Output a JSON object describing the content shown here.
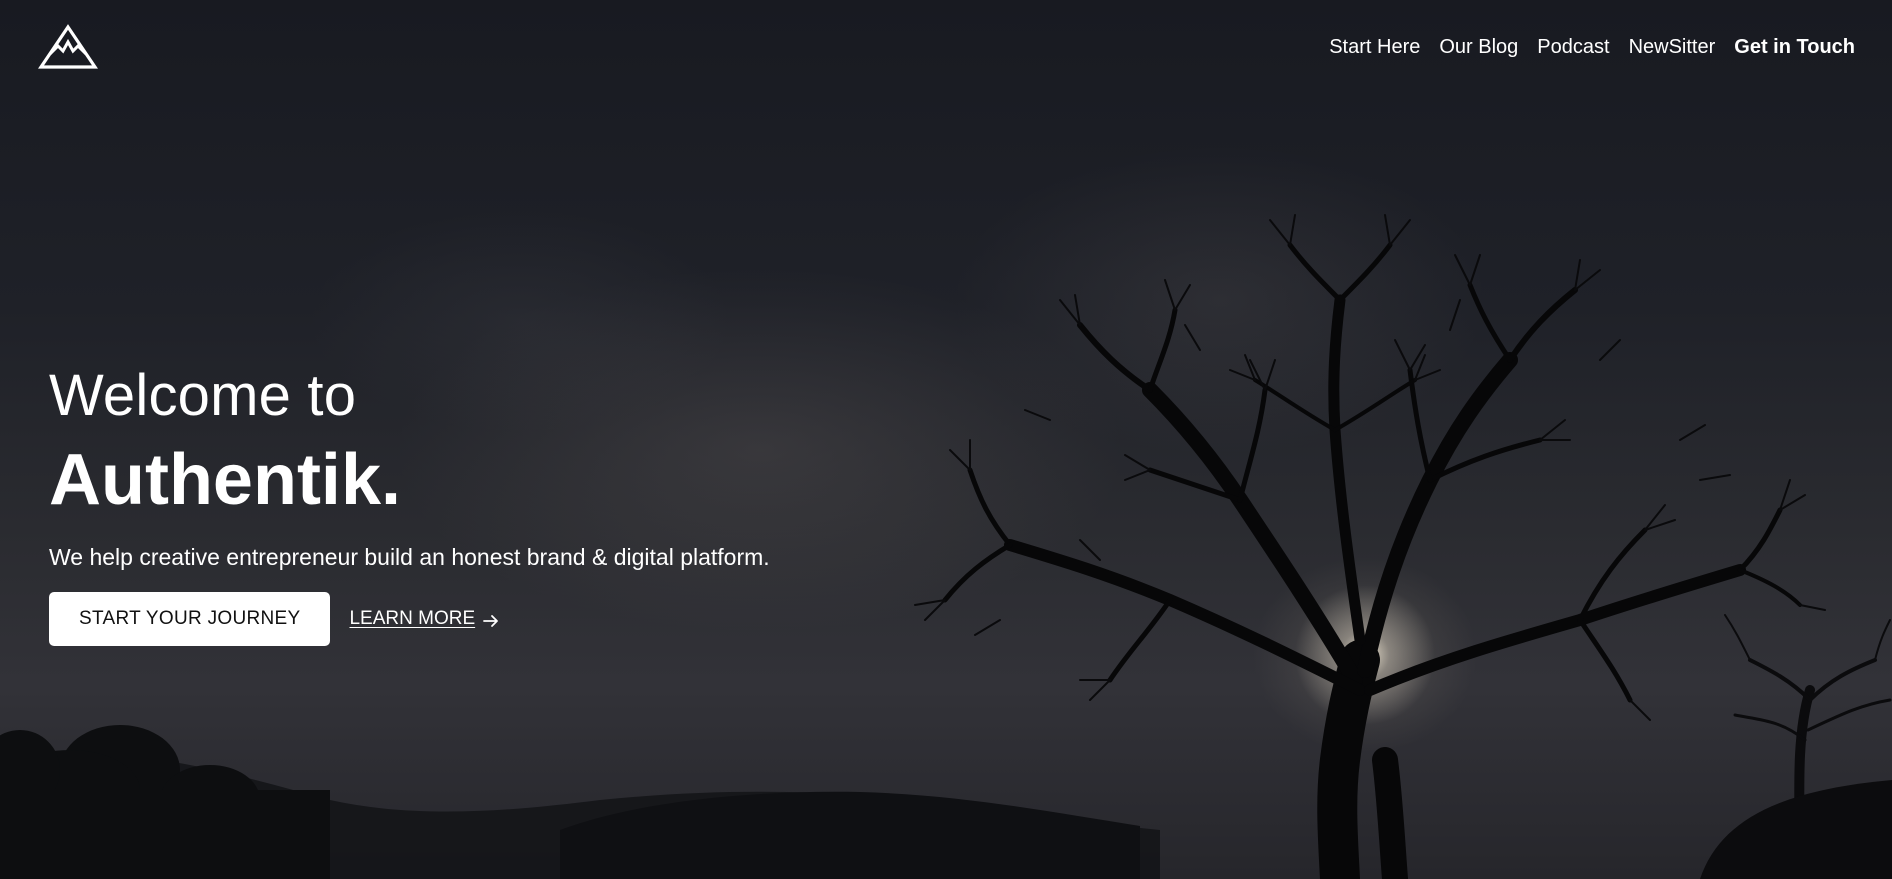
{
  "header": {
    "logo_icon": "mountain-logo-icon",
    "nav": [
      {
        "label": "Start Here"
      },
      {
        "label": "Our Blog"
      },
      {
        "label": "Podcast"
      },
      {
        "label": "NewSitter"
      },
      {
        "label": "Get in Touch"
      }
    ]
  },
  "hero": {
    "welcome": "Welcome to",
    "brand": "Authentik.",
    "tagline": "We help creative entrepreneur build an honest brand & digital platform.",
    "primary_button": "START YOUR JOURNEY",
    "secondary_link": "LEARN MORE",
    "secondary_icon": "arrow-right-icon"
  },
  "colors": {
    "text": "#ffffff",
    "button_bg": "#ffffff",
    "button_text": "#111111",
    "background": "#1f2128"
  }
}
